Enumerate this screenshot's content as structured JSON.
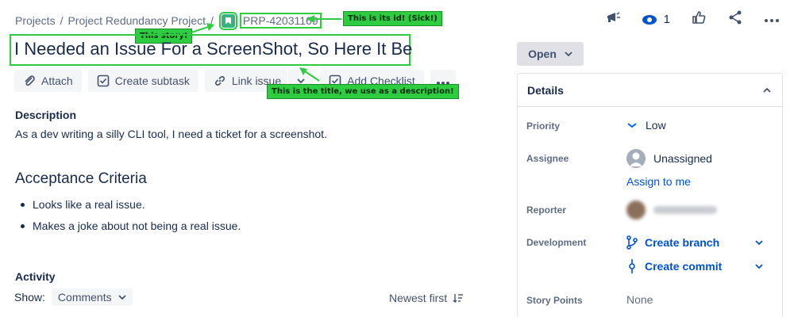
{
  "breadcrumb": {
    "projects": "Projects",
    "sep1": "/",
    "project": "Project Redundancy Project",
    "sep2": "/",
    "issue_key": "PRP-42031169"
  },
  "annotations": {
    "id_note": "This is its id! (Sick!)",
    "story_note": "This story!",
    "title_note": "This is the title, we use as a description!",
    "color": "#2ecc40"
  },
  "top_actions": {
    "watch_count": "1",
    "icons": [
      "megaphone-icon",
      "eye-icon",
      "thumbs-up-icon",
      "share-icon",
      "more-icon"
    ]
  },
  "issue": {
    "title": "I Needed an Issue For a ScreenShot, So Here It Be",
    "issue_type": "story"
  },
  "toolbar": {
    "attach": "Attach",
    "create_subtask": "Create subtask",
    "link_issue": "Link issue",
    "add_checklist": "Add Checklist"
  },
  "description": {
    "heading": "Description",
    "text": "As a dev writing a silly CLI tool, I need a ticket for a screenshot."
  },
  "acceptance": {
    "heading": "Acceptance Criteria",
    "items": [
      "Looks like a real issue.",
      "Makes a joke about not being a real issue."
    ]
  },
  "activity": {
    "heading": "Activity",
    "show_label": "Show:",
    "show_value": "Comments",
    "sort": "Newest first"
  },
  "sidebar": {
    "status": "Open",
    "details_title": "Details",
    "priority_label": "Priority",
    "priority_value": "Low",
    "assignee_label": "Assignee",
    "assignee_value": "Unassigned",
    "assign_to_me": "Assign to me",
    "reporter_label": "Reporter",
    "development_label": "Development",
    "create_branch": "Create branch",
    "create_commit": "Create commit",
    "story_points_label": "Story Points",
    "story_points_value": "None"
  },
  "colors": {
    "link": "#0052cc",
    "text": "#172b4d",
    "muted": "#5e6c84",
    "story_green": "#36b37e"
  }
}
